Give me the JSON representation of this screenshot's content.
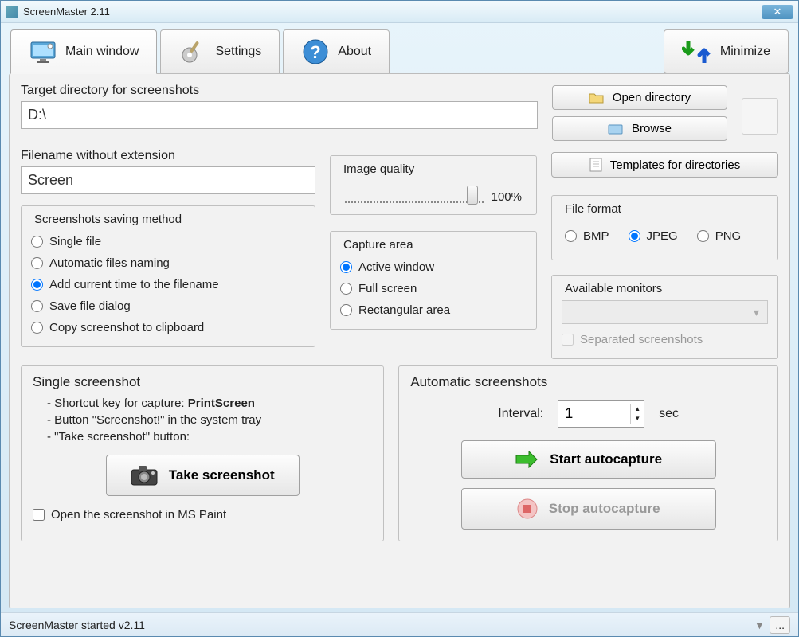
{
  "window": {
    "title": "ScreenMaster 2.11"
  },
  "tabs": {
    "main": "Main window",
    "settings": "Settings",
    "about": "About",
    "minimize": "Minimize"
  },
  "target": {
    "label": "Target directory for screenshots",
    "value": "D:\\",
    "open_dir": "Open directory",
    "browse": "Browse"
  },
  "filename": {
    "label": "Filename without extension",
    "value": "Screen"
  },
  "saving_method": {
    "legend": "Screenshots saving method",
    "single_file": "Single file",
    "auto_naming": "Automatic files naming",
    "add_time": "Add current time to the filename",
    "save_dialog": "Save file dialog",
    "copy_clipboard": "Copy screenshot to clipboard"
  },
  "image_quality": {
    "label": "Image quality",
    "value": "100%"
  },
  "capture_area": {
    "legend": "Capture area",
    "active": "Active window",
    "full": "Full screen",
    "rect": "Rectangular area"
  },
  "templates_btn": "Templates for directories",
  "file_format": {
    "legend": "File format",
    "bmp": "BMP",
    "jpeg": "JPEG",
    "png": "PNG"
  },
  "monitors": {
    "legend": "Available monitors",
    "separated": "Separated screenshots"
  },
  "single": {
    "title": "Single screenshot",
    "line1_prefix": "- Shortcut key for capture:  ",
    "line1_key": "PrintScreen",
    "line2": "- Button \"Screenshot!\" in the system tray",
    "line3": "- \"Take screenshot\" button:",
    "take_btn": "Take screenshot",
    "open_paint": "Open the screenshot in MS Paint"
  },
  "auto": {
    "title": "Automatic screenshots",
    "interval_label": "Interval:",
    "interval_value": "1",
    "interval_unit": "sec",
    "start": "Start autocapture",
    "stop": "Stop autocapture"
  },
  "status": {
    "text": "ScreenMaster started v2.11",
    "more": "..."
  }
}
